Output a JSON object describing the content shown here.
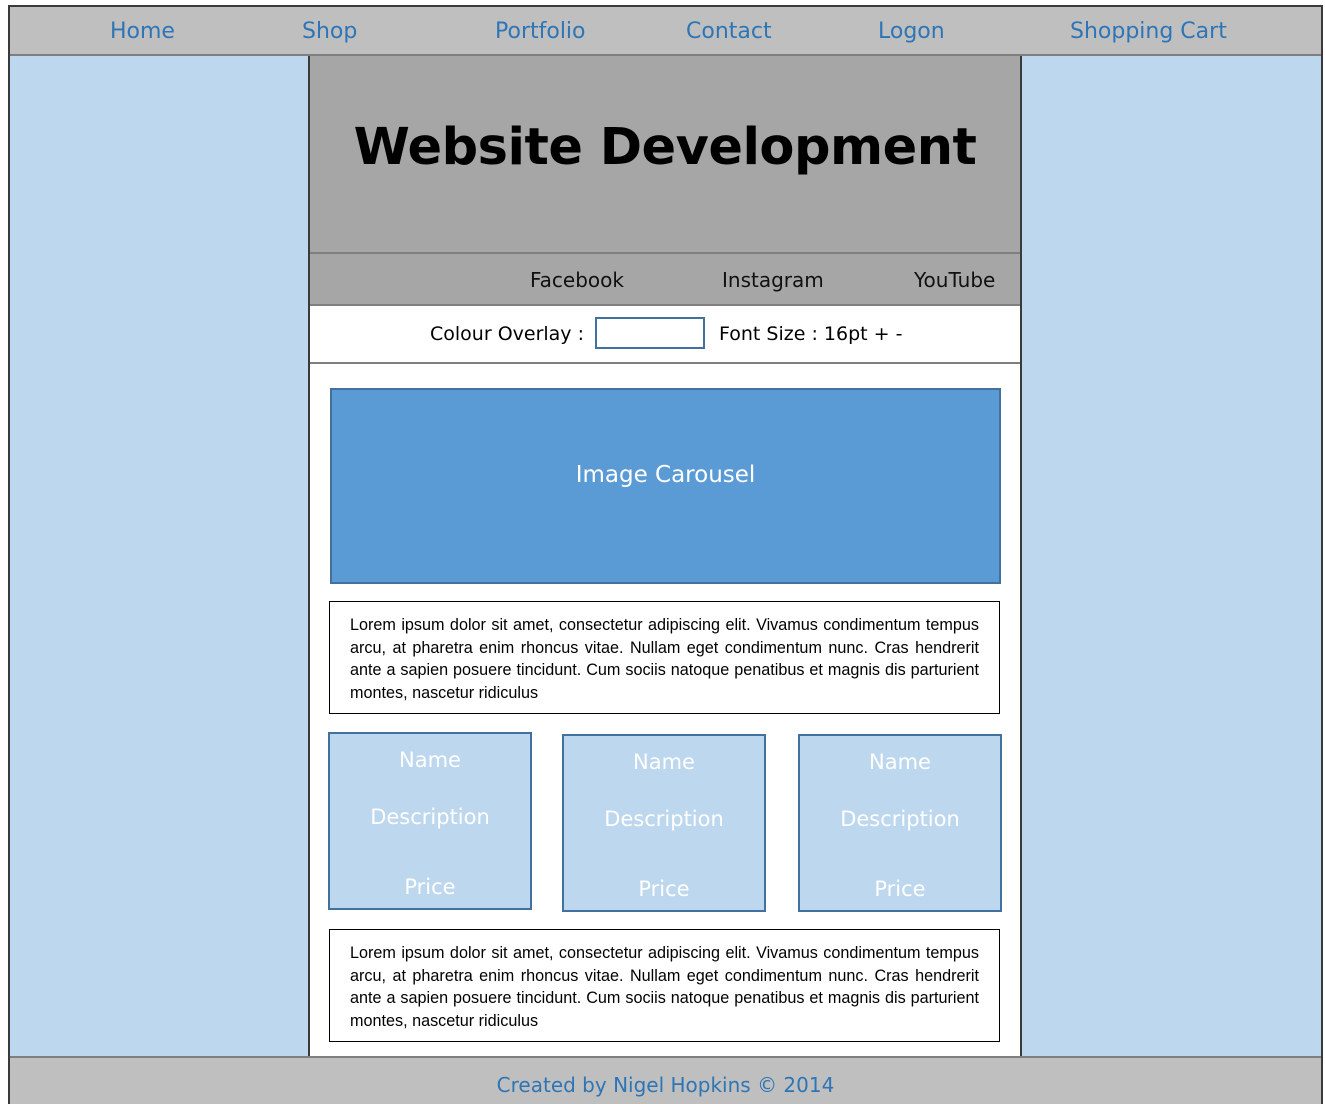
{
  "nav": {
    "home": "Home",
    "shop": "Shop",
    "portfolio": "Portfolio",
    "contact": "Contact",
    "logon": "Logon",
    "cart": "Shopping Cart"
  },
  "header": {
    "title": "Website Development"
  },
  "social": {
    "facebook": "Facebook",
    "instagram": "Instagram",
    "youtube": "YouTube"
  },
  "tools": {
    "overlay_label": "Colour Overlay :",
    "overlay_value": "",
    "font_size_label": "Font Size : 16pt + -"
  },
  "carousel": {
    "label": "Image Carousel"
  },
  "text_blocks": [
    "Lorem ipsum dolor sit amet, consectetur adipiscing elit. Vivamus condimentum tempus arcu, at pharetra enim rhoncus vitae. Nullam eget condimentum nunc. Cras hendrerit ante a sapien posuere tincidunt. Cum sociis natoque penatibus et magnis dis parturient montes, nascetur ridiculus",
    "Lorem ipsum dolor sit amet, consectetur adipiscing elit. Vivamus condimentum tempus arcu, at pharetra enim rhoncus vitae. Nullam eget condimentum nunc. Cras hendrerit ante a sapien posuere tincidunt. Cum sociis natoque penatibus et magnis dis parturient montes, nascetur ridiculus"
  ],
  "products": [
    {
      "name": "Name",
      "description": "Description",
      "price": "Price"
    },
    {
      "name": "Name",
      "description": "Description",
      "price": "Price"
    },
    {
      "name": "Name",
      "description": "Description",
      "price": "Price"
    }
  ],
  "footer": {
    "credit": "Created by Nigel Hopkins © 2014"
  },
  "colors": {
    "accent": "#2e75b6",
    "background": "#bdd7ee",
    "header_gray": "#a6a6a6",
    "nav_gray": "#bfbfbf",
    "carousel_blue": "#5b9bd5"
  }
}
